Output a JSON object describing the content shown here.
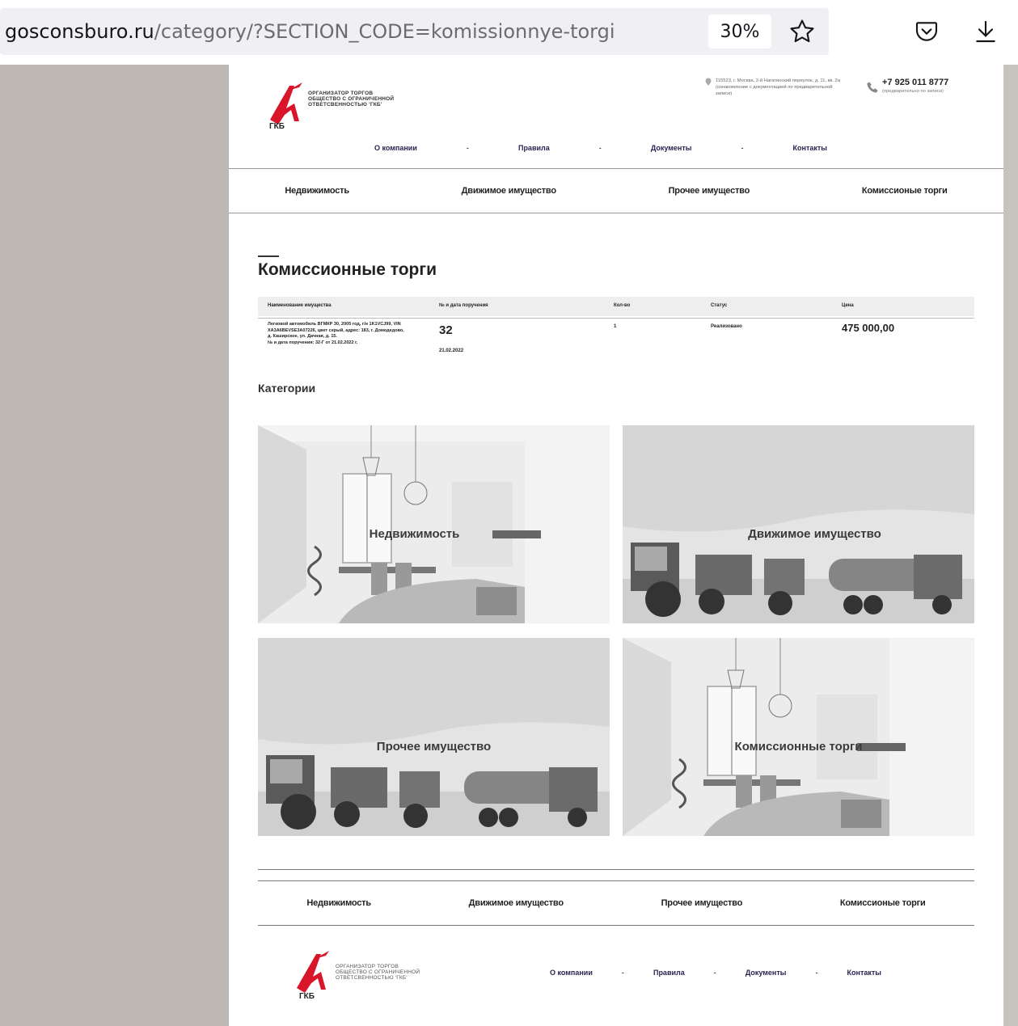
{
  "browser": {
    "url_host": "gosconsburo.ru",
    "url_path": "/category/?SECTION_CODE=komissionnye-torgi",
    "zoom": "30%",
    "icons": [
      "star-icon",
      "pocket-icon",
      "download-icon"
    ]
  },
  "header": {
    "logo_text_lines": [
      "ОРГАНИЗАТОР ТОРГОВ",
      "ОБЩЕСТВО С ОГРАНИЧЕННОЙ",
      "ОТВЕТСВЕННОСТЬЮ 'ГКБ'"
    ],
    "logo_abbr": "ГКБ",
    "address": "115523, г. Москва, 2-й Нагатинский переулок, д. 11, кв. 2а (ознакомление с документацией по предварительной записи)",
    "phone": "+7 925 011 8777",
    "phone_note": "(предварительно по записи)",
    "nav": [
      "О компании",
      "Правила",
      "Документы",
      "Контакты"
    ],
    "nav_separator": "-"
  },
  "category_nav": [
    "Недвижимость",
    "Движимое имущество",
    "Прочее имущество",
    "Комиссионые торги"
  ],
  "page_title": "Комиссионные торги",
  "table": {
    "headers": [
      "Наименование имущества",
      "№ и дата поручения",
      "Кол-во",
      "Статус",
      "Цена"
    ],
    "rows": [
      {
        "description": "Легковой автомобиль ВГМКР 30, 2005 год, г/н 1K1VCJ99, VIN XA3A6BEVSE3A07226, цвет серый, адрес: 183, г. Домодедово, д. Каширское, ул. Дачная, д. 15.",
        "description_note": "№ и дата поручения: 32-Г от 21.02.2022 г.",
        "lot_number": "32",
        "lot_date": "21.02.2022",
        "quantity": "1",
        "status": "Реализовано",
        "price": "475 000,00"
      }
    ]
  },
  "categories_heading": "Категории",
  "cards": [
    {
      "label": "Недвижимость",
      "image": "interior"
    },
    {
      "label": "Движимое имущество",
      "image": "machinery"
    },
    {
      "label": "Прочее имущество",
      "image": "machinery"
    },
    {
      "label": "Комиссионные торги",
      "image": "interior"
    }
  ],
  "footer": {
    "category_nav": [
      "Недвижимость",
      "Движимое имущество",
      "Прочее имущество",
      "Комиссионые торги"
    ],
    "logo_text_lines": [
      "ОРГАНИЗАТОР ТОРГОВ",
      "ОБЩЕСТВО С ОГРАНИЧЕННОЙ",
      "ОТВЕТСВЕННОСТЬЮ 'ГКБ'"
    ],
    "logo_abbr": "ГКБ",
    "nav": [
      "О компании",
      "Правила",
      "Документы",
      "Контакты"
    ],
    "nav_separator": "-"
  },
  "colors": {
    "accent_red": "#d9152a",
    "nav_text": "#2a2350",
    "side_gray": "#bdb8b4"
  }
}
